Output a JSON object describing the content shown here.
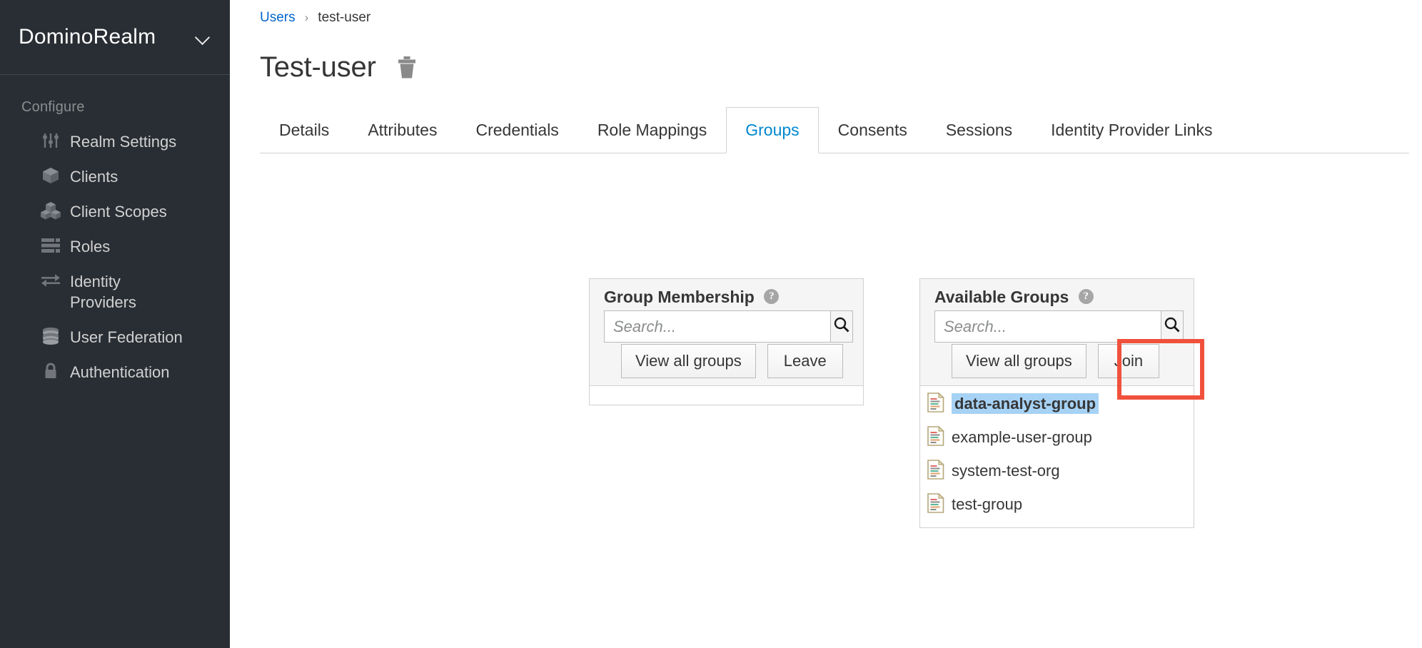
{
  "sidebar": {
    "realm_name": "DominoRealm",
    "realm_chevron_icon": "chevron-down-icon",
    "section_label": "Configure",
    "items": [
      {
        "label": "Realm Settings",
        "icon": "sliders-icon",
        "name": "realm-settings"
      },
      {
        "label": "Clients",
        "icon": "cube-icon",
        "name": "clients"
      },
      {
        "label": "Client Scopes",
        "icon": "cubes-icon",
        "name": "client-scopes"
      },
      {
        "label": "Roles",
        "icon": "list-icon",
        "name": "roles"
      },
      {
        "label": "Identity Providers",
        "icon": "exchange-arrows-icon",
        "name": "identity-providers"
      },
      {
        "label": "User Federation",
        "icon": "database-icon",
        "name": "user-federation"
      },
      {
        "label": "Authentication",
        "icon": "lock-icon",
        "name": "authentication"
      }
    ]
  },
  "breadcrumb": {
    "parent": "Users",
    "separator": "›",
    "current": "test-user"
  },
  "page": {
    "title": "Test-user",
    "delete_icon": "trash-icon"
  },
  "tabs": [
    {
      "label": "Details",
      "active": false
    },
    {
      "label": "Attributes",
      "active": false
    },
    {
      "label": "Credentials",
      "active": false
    },
    {
      "label": "Role Mappings",
      "active": false
    },
    {
      "label": "Groups",
      "active": true
    },
    {
      "label": "Consents",
      "active": false
    },
    {
      "label": "Sessions",
      "active": false
    },
    {
      "label": "Identity Provider Links",
      "active": false
    }
  ],
  "membership_panel": {
    "title": "Group Membership",
    "help_icon": "question-circle-icon",
    "search_placeholder": "Search...",
    "search_value": "",
    "search_icon": "search-icon",
    "view_all_label": "View all groups",
    "action_label": "Leave",
    "groups": []
  },
  "available_panel": {
    "title": "Available Groups",
    "help_icon": "question-circle-icon",
    "search_placeholder": "Search...",
    "search_value": "",
    "search_icon": "search-icon",
    "view_all_label": "View all groups",
    "action_label": "Join",
    "groups": [
      {
        "name": "data-analyst-group",
        "selected": true
      },
      {
        "name": "example-user-group",
        "selected": false
      },
      {
        "name": "system-test-org",
        "selected": false
      },
      {
        "name": "test-group",
        "selected": false
      }
    ]
  },
  "annotation": {
    "target": "join-button",
    "color": "#f0513c"
  },
  "colors": {
    "sidebar_bg": "#292e34",
    "link_blue": "#0066cc",
    "active_tab": "#0088ce",
    "selection_blue": "#a6d2f5",
    "highlight_red": "#f0513c"
  }
}
